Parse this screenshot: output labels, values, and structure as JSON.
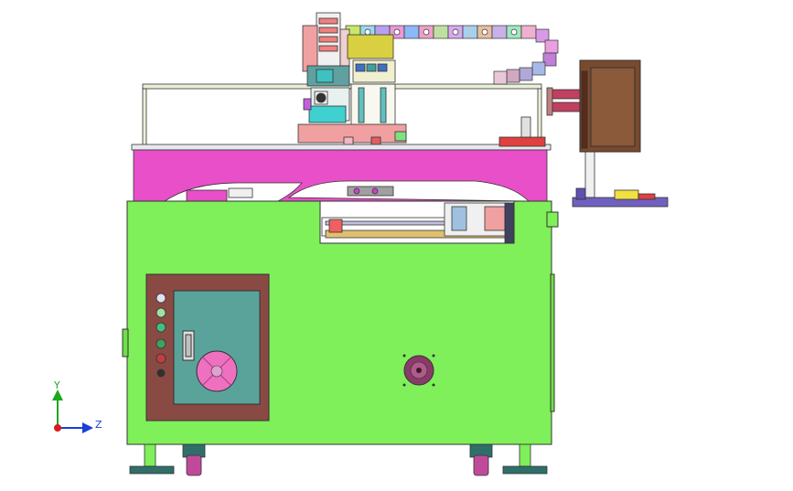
{
  "viewport": {
    "background": "#ffffff"
  },
  "axis_triad": {
    "y_label": "Y",
    "z_label": "Z",
    "y_color": "#1aa81a",
    "z_color": "#1a3fd8",
    "origin_color": "#d81a1a"
  },
  "colors": {
    "cabinet": "#7fef5a",
    "gantry": "#e84fc8",
    "door_frame": "#8a4a44",
    "door_glass": "#5aa39a",
    "monitor": "#7a4a2c",
    "cable_chain": "#d07ad8",
    "feet": "#2f6f6a",
    "wheels": "#c04a9a"
  },
  "icons": {
    "door_fan": "fan-icon",
    "cabinet_fan": "fan-icon"
  }
}
